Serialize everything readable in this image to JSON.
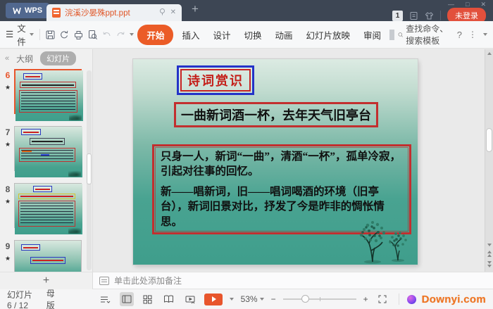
{
  "titlebar": {
    "app_name": "WPS",
    "tab_title": "浣溪沙晏殊ppt.ppt",
    "doc_count": "1",
    "login_label": "未登录"
  },
  "menubar": {
    "file_label": "文件",
    "tabs": [
      {
        "label": "开始"
      },
      {
        "label": "插入"
      },
      {
        "label": "设计"
      },
      {
        "label": "切换"
      },
      {
        "label": "动画"
      },
      {
        "label": "幻灯片放映"
      },
      {
        "label": "审阅"
      }
    ],
    "search_label": "查找命令、搜索模板"
  },
  "sidebar": {
    "outline_label": "大纲",
    "slides_label": "幻灯片",
    "slides": [
      {
        "number": "6"
      },
      {
        "number": "7"
      },
      {
        "number": "8"
      },
      {
        "number": "9"
      }
    ]
  },
  "slide": {
    "title": "诗词赏识",
    "poem_line": "一曲新词酒一杯，去年天气旧亭台",
    "paragraph1": "只身一人，新词“一曲”，清酒“一杯”，孤单冷寂，引起对往事的回忆。",
    "paragraph2": "新——唱新词，旧——唱词喝酒的环境（旧亭台），新词旧景对比，抒发了今是昨非的惆怅情思。"
  },
  "notes": {
    "placeholder": "单击此处添加备注"
  },
  "statusbar": {
    "slide_counter": "幻灯片 6 / 12",
    "master_label": "母版",
    "zoom_level": "53%",
    "watermark": "Downyi.com"
  },
  "glyphs": {
    "hamburger": "☰",
    "collapse_sidebar": "«",
    "star": "★",
    "plus": "+",
    "minus": "−",
    "help": "?",
    "more": "⋮",
    "tab_close": "✕",
    "win_min": "—",
    "win_max": "□",
    "win_close": "✕"
  },
  "colors": {
    "accent_orange": "#e8552c",
    "titlebar_bg": "#3d4654",
    "slide_teal": "#3f9e8c",
    "box_red": "#c22f2f",
    "box_blue": "#2433c8",
    "title_red": "#c41f1a",
    "watermark_orange": "#f0731f"
  }
}
